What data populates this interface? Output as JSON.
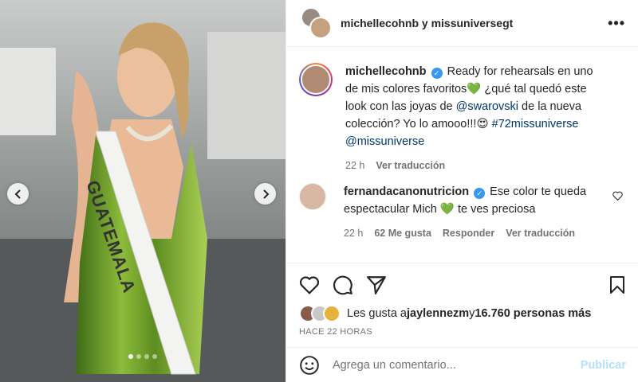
{
  "post": {
    "header_title": "michellecohnb y missuniversegt",
    "more_label": "•••",
    "image_dots": 4,
    "active_dot": 0
  },
  "caption": {
    "username": "michellecohnb",
    "text_1": "Ready for rehearsals en uno de mis colores favoritos💚 ¿qué tal quedó este look con las joyas de ",
    "mention_1": "@swarovski",
    "text_2": " de la nueva colección? Yo lo amooo!!!😍 ",
    "hashtag": "#72missuniverse",
    "mention_2": "@missuniverse",
    "time": "22 h",
    "translate": "Ver traducción"
  },
  "comment": {
    "username": "fernandacanonutricion",
    "text": "Ese color te queda espectacular Mich 💚 te ves preciosa",
    "time": "22 h",
    "likes": "62 Me gusta",
    "reply": "Responder",
    "translate": "Ver traducción"
  },
  "likes": {
    "prefix": "Les gusta a ",
    "user": "jaylennezm",
    "joiner": " y ",
    "others": "16.760 personas más",
    "ago": "HACE 22 HORAS"
  },
  "composer": {
    "placeholder": "Agrega un comentario...",
    "publish": "Publicar"
  },
  "colors": {
    "link": "#00376b",
    "verified": "#3897f0",
    "publish_disabled": "#b2dffc",
    "dress_green": "#6e9b2c"
  },
  "icons": [
    "chevron-left-icon",
    "chevron-right-icon",
    "more-icon",
    "verified-icon",
    "heart-icon",
    "comment-icon",
    "share-icon",
    "bookmark-icon",
    "emoji-icon"
  ]
}
